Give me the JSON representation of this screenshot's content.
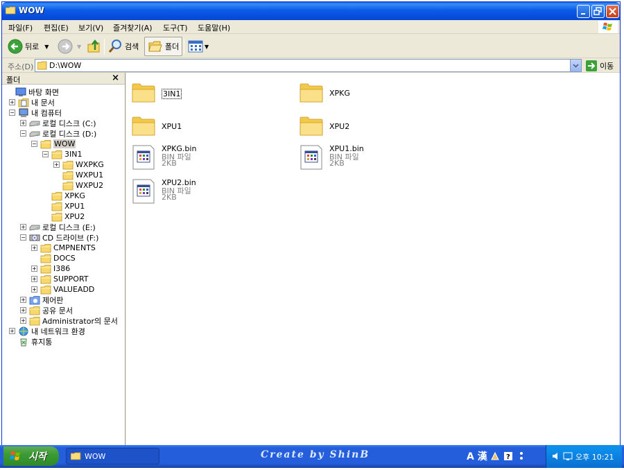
{
  "window": {
    "title": "WOW"
  },
  "menu": [
    "파일(F)",
    "편집(E)",
    "보기(V)",
    "즐겨찾기(A)",
    "도구(T)",
    "도움말(H)"
  ],
  "toolbar": {
    "back": "뒤로",
    "search": "검색",
    "folders": "폴더"
  },
  "address": {
    "label": "주소(D)",
    "value": "D:\\WOW",
    "go": "이동"
  },
  "folder_pane": {
    "title": "폴더",
    "close": "×",
    "tree": [
      {
        "label": "바탕 화면"
      },
      {
        "label": "내 문서"
      },
      {
        "label": "내 컴퓨터"
      },
      {
        "label": "로컬 디스크 (C:)"
      },
      {
        "label": "로컬 디스크 (D:)"
      },
      {
        "label": "WOW"
      },
      {
        "label": "3IN1"
      },
      {
        "label": "WXPKG"
      },
      {
        "label": "WXPU1"
      },
      {
        "label": "WXPU2"
      },
      {
        "label": "XPKG"
      },
      {
        "label": "XPU1"
      },
      {
        "label": "XPU2"
      },
      {
        "label": "로컬 디스크 (E:)"
      },
      {
        "label": "CD 드라이브 (F:)"
      },
      {
        "label": "CMPNENTS"
      },
      {
        "label": "DOCS"
      },
      {
        "label": "I386"
      },
      {
        "label": "SUPPORT"
      },
      {
        "label": "VALUEADD"
      },
      {
        "label": "제어판"
      },
      {
        "label": "공유 문서"
      },
      {
        "label": "Administrator의 문서"
      },
      {
        "label": "내 네트워크 환경"
      },
      {
        "label": "휴지통"
      }
    ]
  },
  "items": [
    {
      "name": "3IN1"
    },
    {
      "name": "XPKG"
    },
    {
      "name": "XPU1"
    },
    {
      "name": "XPU2"
    },
    {
      "name": "XPKG.bin",
      "type": "BIN 파일",
      "size": "2KB"
    },
    {
      "name": "XPU1.bin",
      "type": "BIN 파일",
      "size": "2KB"
    },
    {
      "name": "XPU2.bin",
      "type": "BIN 파일",
      "size": "2KB"
    }
  ],
  "taskbar": {
    "start": "시작",
    "task": "WOW",
    "credit": "Create by ShinB",
    "ime": "A 漢",
    "clock": "오후 10:21"
  },
  "colors": {
    "titlebar": "#0b5ce8",
    "taskbar": "#245edb",
    "start": "#3c9b34",
    "folder": "#f5d76e"
  }
}
